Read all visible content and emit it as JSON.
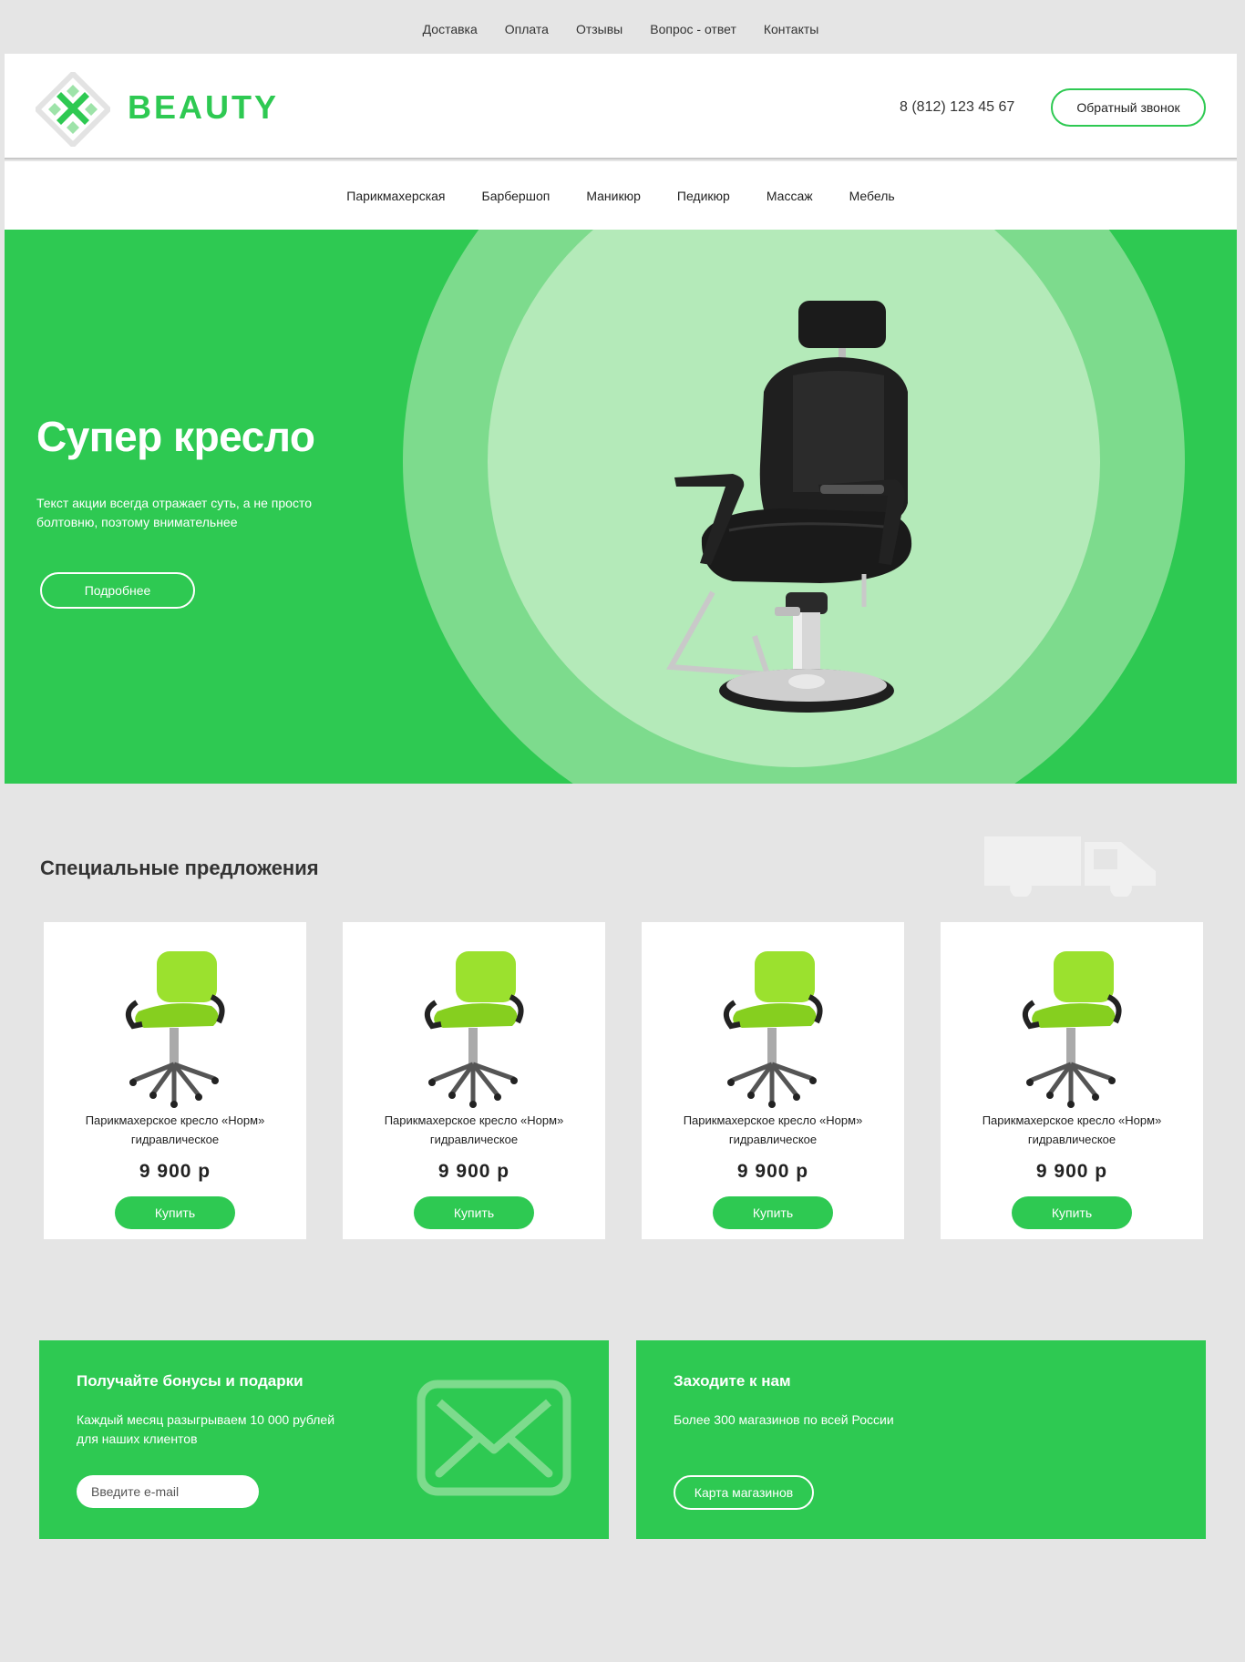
{
  "topnav": [
    "Доставка",
    "Оплата",
    "Отзывы",
    "Вопрос - ответ",
    "Контакты"
  ],
  "header": {
    "brand": "BEAUTY",
    "phone": "8 (812) 123 45 67",
    "callback_label": "Обратный звонок",
    "logo_icon": "logo-icon"
  },
  "catnav": [
    "Парикмахерская",
    "Барбершоп",
    "Маникюр",
    "Педикюр",
    "Массаж",
    "Мебель"
  ],
  "hero": {
    "title": "Супер кресло",
    "text": "Текст акции всегда отражает суть, а не просто болтовню, поэтому внимательнее",
    "button_label": "Подробнее"
  },
  "offers": {
    "title": "Специальные предложения",
    "products": [
      {
        "name": "Парикмахерское кресло «Норм» гидравлическое",
        "price": "9 900 р",
        "buy_label": "Купить"
      },
      {
        "name": "Парикмахерское кресло «Норм» гидравлическое",
        "price": "9 900 р",
        "buy_label": "Купить"
      },
      {
        "name": "Парикмахерское кресло «Норм» гидравлическое",
        "price": "9 900 р",
        "buy_label": "Купить"
      },
      {
        "name": "Парикмахерское кресло «Норм» гидравлическое",
        "price": "9 900 р",
        "buy_label": "Купить"
      }
    ]
  },
  "promo_bonus": {
    "title": "Получайте бонусы и подарки",
    "text": "Каждый месяц разыгрываем 10 000 рублей для наших клиентов",
    "email_placeholder": "Введите e-mail"
  },
  "promo_stores": {
    "title": "Заходите к нам",
    "text": "Более 300 магазинов по всей России",
    "button_label": "Карта магазинов"
  },
  "colors": {
    "accent": "#2ec952",
    "ring_outer": "#7ddb8d",
    "ring_inner": "#b4eab9",
    "background": "#e5e5e5"
  }
}
